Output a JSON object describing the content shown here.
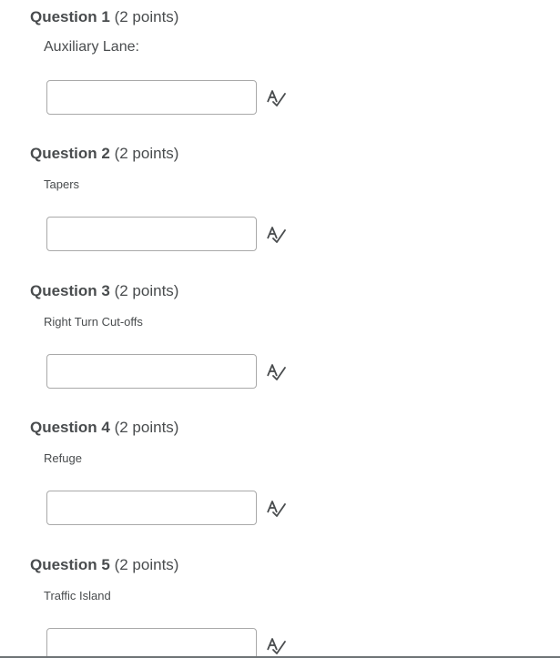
{
  "questions": [
    {
      "label": "Question 1",
      "points": "(2 points)",
      "text": "Auxiliary Lane:",
      "answer_value": ""
    },
    {
      "label": "Question 2",
      "points": "(2 points)",
      "text": "Tapers",
      "answer_value": ""
    },
    {
      "label": "Question 3",
      "points": "(2 points)",
      "text": "Right Turn Cut-offs",
      "answer_value": ""
    },
    {
      "label": "Question 4",
      "points": "(2 points)",
      "text": "Refuge",
      "answer_value": ""
    },
    {
      "label": "Question 5",
      "points": "(2 points)",
      "text": "Traffic Island",
      "answer_value": ""
    }
  ],
  "icons": {
    "spellcheck": "spellcheck-icon"
  },
  "colors": {
    "text": "#494c4e",
    "input_border": "#a9a9a9",
    "icon": "#494c4e"
  }
}
